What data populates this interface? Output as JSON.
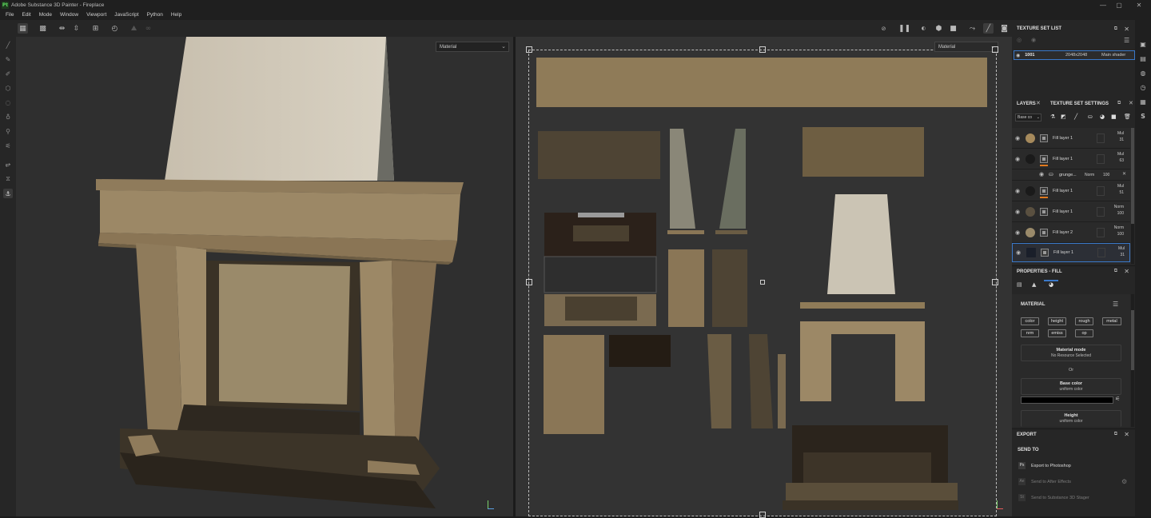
{
  "window": {
    "title": "Adobe Substance 3D Painter - Fireplace",
    "app_badge": "Pt",
    "controls": [
      "—",
      "▢",
      "✕"
    ]
  },
  "menu": [
    "File",
    "Edit",
    "Mode",
    "Window",
    "Viewport",
    "JavaScript",
    "Python",
    "Help"
  ],
  "viewport3d": {
    "channel": "Material"
  },
  "viewport2d": {
    "channel": "Material"
  },
  "texture_set_list": {
    "title": "TEXTURE SET LIST",
    "row": {
      "name": "1001",
      "resolution": "2048x2048",
      "shader": "Main shader"
    }
  },
  "layers": {
    "tab_layers": "LAYERS",
    "tab_settings": "TEXTURE SET SETTINGS",
    "channel_select": "Base co",
    "items": [
      {
        "name": "Fill layer 1",
        "blend": "Mul",
        "opacity": "31",
        "thumb": "#a68a5c",
        "orange": false
      },
      {
        "name": "Fill layer 1",
        "blend": "Mul",
        "opacity": "63",
        "thumb": "#1a1a1a",
        "orange": true
      },
      {
        "name": "Fill layer 1",
        "blend": "Mul",
        "opacity": "51",
        "thumb": "#1a1a1a",
        "orange": true
      },
      {
        "name": "Fill layer 1",
        "blend": "Norm",
        "opacity": "100",
        "thumb": "#5a5040",
        "orange": false
      },
      {
        "name": "Fill layer 2",
        "blend": "Norm",
        "opacity": "100",
        "thumb": "#9a8a6a",
        "orange": false
      },
      {
        "name": "Fill layer 1",
        "blend": "Mul",
        "opacity": "31",
        "thumb": "#1a1f2a",
        "orange": false
      }
    ],
    "effect": {
      "name": "grunge...",
      "blend": "Norm",
      "opacity": "100"
    }
  },
  "properties": {
    "title": "PROPERTIES - FILL",
    "section": "MATERIAL",
    "channels": [
      "color",
      "height",
      "rough",
      "metal",
      "nrm",
      "emiss",
      "op"
    ],
    "material_mode": {
      "label": "Material mode",
      "value": "No Resource Selected"
    },
    "or": "Or",
    "base_color": {
      "label": "Base color",
      "value": "uniform color",
      "swatch": "#000000"
    },
    "height": {
      "label": "Height",
      "value": "uniform color"
    }
  },
  "export": {
    "title": "EXPORT",
    "send_to": "SEND TO",
    "items": [
      {
        "label": "Export to Photoshop",
        "enabled": true
      },
      {
        "label": "Send to After Effects",
        "enabled": false
      },
      {
        "label": "Send to Substance 3D Stager",
        "enabled": false
      }
    ]
  },
  "colors": {
    "accent": "#3a78c8",
    "orange": "#e07a1f",
    "stone": "#a68a5c"
  }
}
